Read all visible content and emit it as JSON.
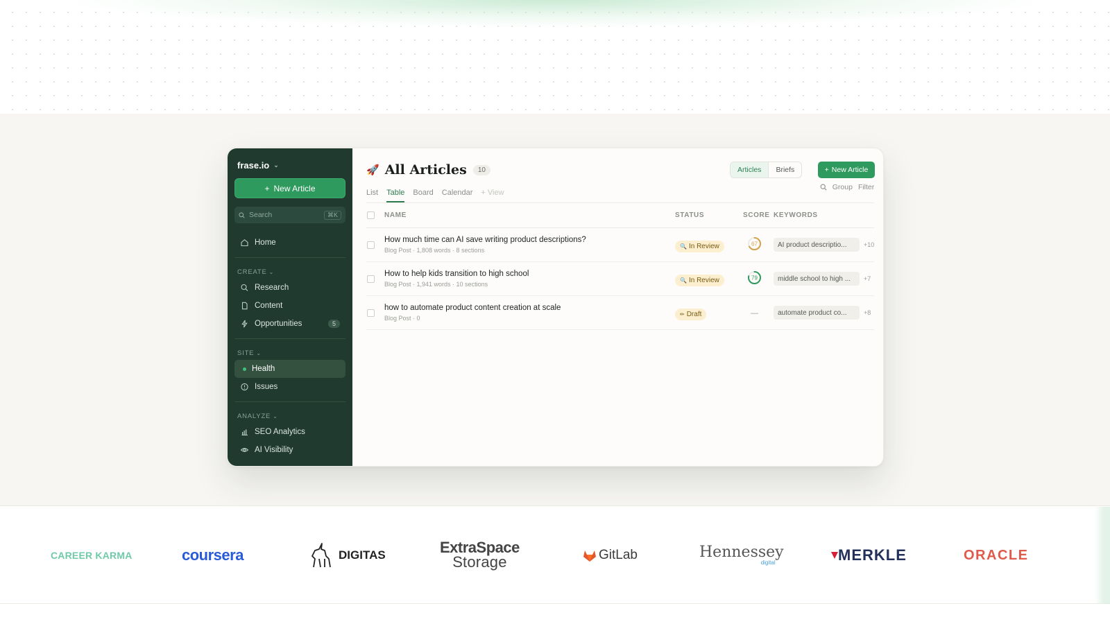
{
  "sidebar": {
    "workspace": "frase.io",
    "new_article": "New Article",
    "search_placeholder": "Search",
    "search_shortcut": "⌘K",
    "home": "Home",
    "sections": {
      "create": "CREATE",
      "site": "SITE",
      "analyze": "ANALYZE"
    },
    "create_items": [
      {
        "label": "Research",
        "icon": "search-icon"
      },
      {
        "label": "Content",
        "icon": "document-icon"
      },
      {
        "label": "Opportunities",
        "icon": "bolt-icon",
        "count": "5"
      }
    ],
    "site_items": [
      {
        "label": "Health",
        "icon": "status-dot-icon",
        "active": true
      },
      {
        "label": "Issues",
        "icon": "alert-circle-icon"
      }
    ],
    "analyze_items": [
      {
        "label": "SEO Analytics",
        "icon": "bar-chart-icon"
      },
      {
        "label": "AI Visibility",
        "icon": "eye-icon"
      }
    ]
  },
  "header": {
    "title": "All Articles",
    "count": "10",
    "toggle": [
      "Articles",
      "Briefs"
    ],
    "toggle_selected": "Articles",
    "new_article": "New Article"
  },
  "views": {
    "tabs": [
      "List",
      "Table",
      "Board",
      "Calendar"
    ],
    "selected": "Table",
    "add_view": "+ View",
    "tools": [
      "Group",
      "Filter"
    ]
  },
  "table": {
    "columns": [
      "NAME",
      "STATUS",
      "SCORE",
      "KEYWORDS"
    ],
    "rows": [
      {
        "name": "How much time can AI save writing product descriptions?",
        "meta": "Blog Post · 1,808 words · 8 sections",
        "status": "In Review",
        "status_icon": "magnifier-icon",
        "score": "67",
        "score_value": 67,
        "score_color": "#d4a24a",
        "keyword": "AI product descriptio...",
        "keyword_more": "+10"
      },
      {
        "name": "How to help kids transition to high school",
        "meta": "Blog Post · 1,941 words · 10 sections",
        "status": "In Review",
        "status_icon": "magnifier-icon",
        "score": "79",
        "score_value": 79,
        "score_color": "#2f9a5e",
        "keyword": "middle school to high ...",
        "keyword_more": "+7"
      },
      {
        "name": "how to automate product content creation at scale",
        "meta": "Blog Post · 0",
        "status": "Draft",
        "status_icon": "pencil-icon",
        "score": "—",
        "score_value": null,
        "score_color": "#9a9d98",
        "keyword": "automate product co...",
        "keyword_more": "+8"
      }
    ]
  },
  "logos": [
    "CAREER KARMA",
    "coursera",
    "DIGITAS",
    "ExtraSpace",
    "Storage",
    "GitLab",
    "Hennessey",
    "digital",
    "MERKLE",
    "ORACLE"
  ],
  "colors": {
    "accent": "#2f9a5e",
    "sidebar_bg": "#213a30",
    "status_bg": "#fbefcf"
  }
}
